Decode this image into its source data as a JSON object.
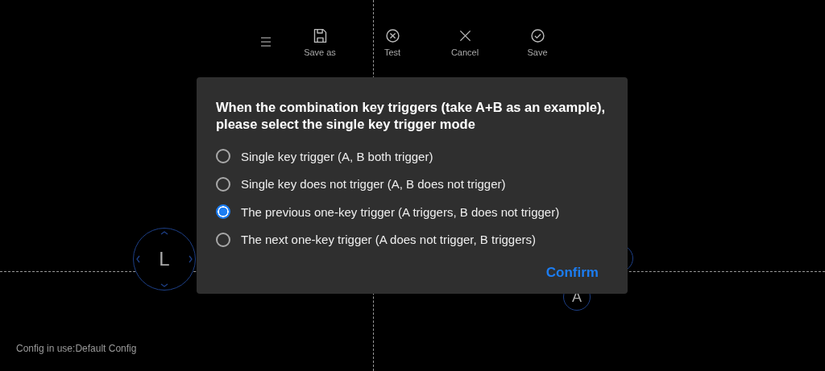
{
  "toolbar": {
    "items": [
      {
        "kind": "save-as",
        "label": "Save as"
      },
      {
        "kind": "test",
        "label": "Test"
      },
      {
        "kind": "cancel",
        "label": "Cancel"
      },
      {
        "kind": "save",
        "label": "Save"
      }
    ]
  },
  "canvas": {
    "joystick": {
      "label": "L"
    },
    "keys": [
      {
        "label": "A"
      }
    ]
  },
  "dialog": {
    "title": "When the combination key triggers (take A+B as an example), please select the single key trigger mode",
    "options": [
      {
        "label": "Single key trigger (A, B both trigger)",
        "selected": false
      },
      {
        "label": "Single key does not trigger (A, B does not trigger)",
        "selected": false
      },
      {
        "label": "The previous one-key trigger (A triggers, B does not trigger)",
        "selected": true
      },
      {
        "label": "The next one-key trigger (A does not trigger, B triggers)",
        "selected": false
      }
    ],
    "confirm": "Confirm"
  },
  "status": "Config in use:Default Config"
}
